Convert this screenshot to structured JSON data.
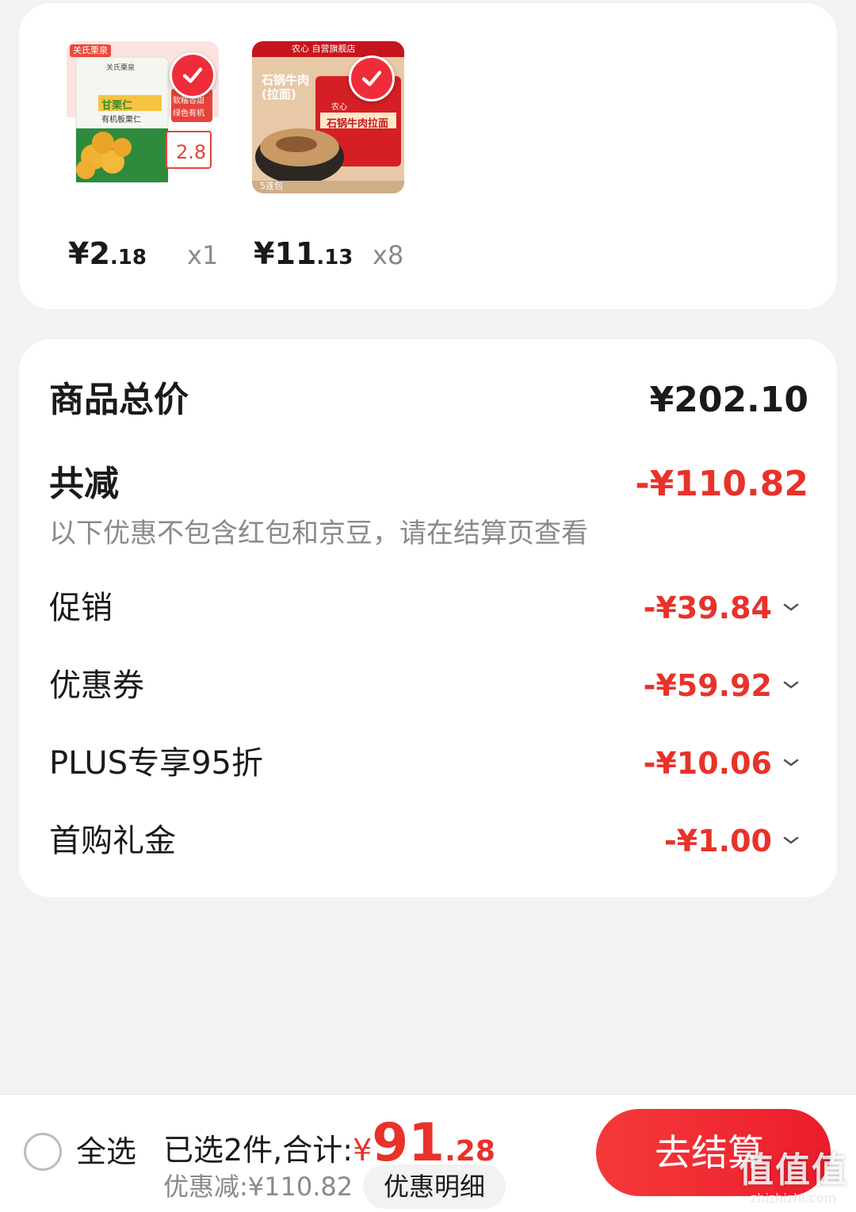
{
  "products": [
    {
      "brand_tag": "关氏栗泉",
      "image_texts": [
        "关氏栗泉",
        "甘栗仁",
        "有机板栗仁",
        "软糯香甜",
        "绿色有机",
        "2.8"
      ],
      "price_int": "¥2",
      "price_dec": ".18",
      "qty": "x1"
    },
    {
      "brand_tag": "农心 自营旗舰店",
      "image_texts": [
        "石锅牛肉",
        "(拉面)",
        "农心",
        "石锅牛肉拉面",
        "5连包"
      ],
      "price_int": "¥11",
      "price_dec": ".13",
      "qty": "x8"
    }
  ],
  "summary": {
    "total_label": "商品总价",
    "total_value": "¥202.10",
    "reduce_label": "共减",
    "reduce_value": "-¥110.82",
    "note": "以下优惠不包含红包和京豆，请在结算页查看",
    "items": [
      {
        "label": "促销",
        "value": "-¥39.84"
      },
      {
        "label": "优惠券",
        "value": "-¥59.92"
      },
      {
        "label": "PLUS专享95折",
        "value": "-¥10.06"
      },
      {
        "label": "首购礼金",
        "value": "-¥1.00"
      }
    ]
  },
  "bottom": {
    "select_all": "全选",
    "selected_text": "已选2件,合计:",
    "currency": "¥",
    "total_int": "91",
    "total_dec": ".28",
    "discount_text": "优惠减:¥110.82",
    "detail_button": "优惠明细",
    "checkout_button": "去结算"
  },
  "watermark": {
    "logo": "值值值",
    "site": "zhizhizhi.com"
  },
  "colors": {
    "accent": "#e8322a",
    "checkout": "#f0283a",
    "background": "#f2f2f2"
  }
}
